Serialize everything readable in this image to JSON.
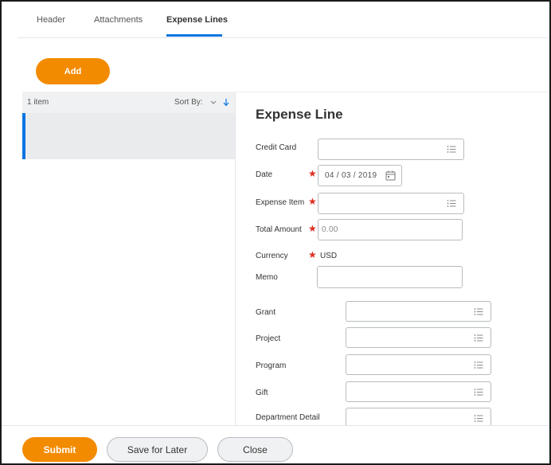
{
  "tabs": [
    {
      "label": "Header"
    },
    {
      "label": "Attachments"
    },
    {
      "label": "Expense Lines"
    }
  ],
  "add_button_label": "Add",
  "list": {
    "count_text": "1 item",
    "sort_by_label": "Sort By:"
  },
  "form": {
    "title": "Expense Line",
    "required_marker": "★",
    "credit_card": {
      "label": "Credit Card"
    },
    "date": {
      "label": "Date",
      "value": "04 / 03 / 2019"
    },
    "expense_item": {
      "label": "Expense Item"
    },
    "total_amount": {
      "label": "Total Amount",
      "placeholder": "0.00"
    },
    "currency": {
      "label": "Currency",
      "value": "USD"
    },
    "memo": {
      "label": "Memo"
    },
    "grant": {
      "label": "Grant"
    },
    "project": {
      "label": "Project"
    },
    "program": {
      "label": "Program"
    },
    "gift": {
      "label": "Gift"
    },
    "department_detail": {
      "label": "Department Detail"
    }
  },
  "footer": {
    "submit_label": "Submit",
    "save_label": "Save for Later",
    "close_label": "Close"
  },
  "colors": {
    "accent_orange": "#f38b00",
    "accent_blue": "#0875e1",
    "required_red": "#de2e21"
  },
  "icons": {
    "prompt": "prompt-list-icon",
    "calendar": "calendar-icon",
    "sort_direction": "sort-down-arrow-icon"
  }
}
